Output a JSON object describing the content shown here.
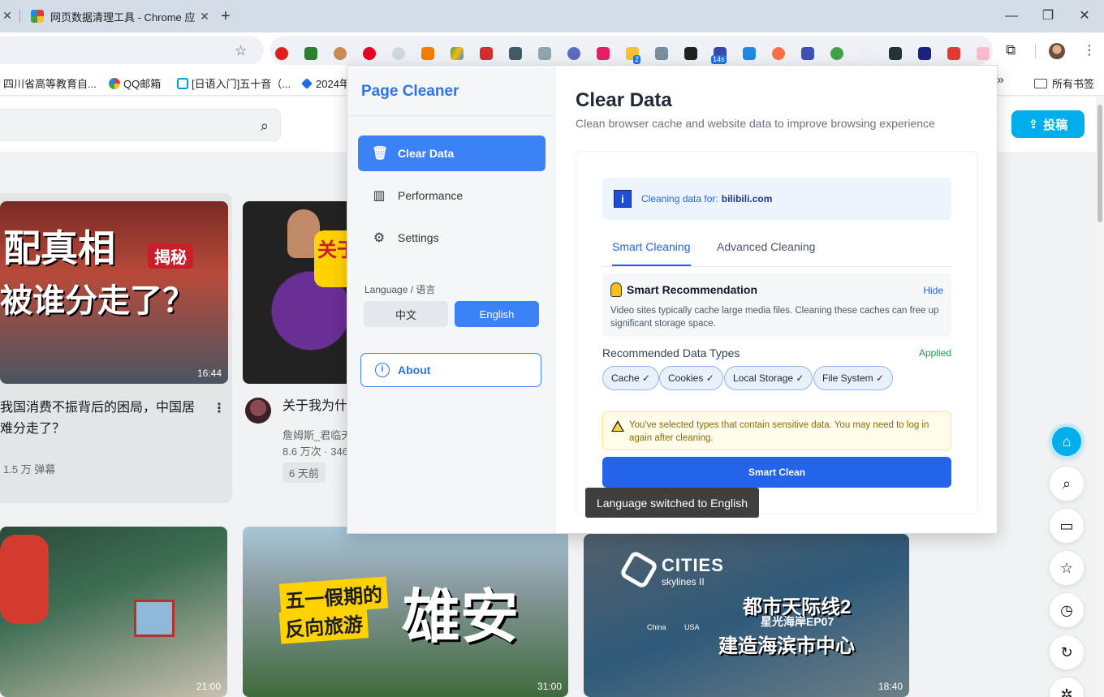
{
  "browser": {
    "tab_title": "网页数据清理工具 - Chrome 应",
    "bookmarks": [
      "四川省高等教育自...",
      "QQ邮箱",
      "[日语入门]五十音（...",
      "2024年"
    ],
    "all_bookmarks": "所有书签",
    "ext_badge_1": "2",
    "ext_badge_2": "14s"
  },
  "page": {
    "upload_label": "投稿",
    "card1": {
      "thumb_line1": "配真相",
      "thumb_line2": "被谁分走了？",
      "thumb_tag": "揭秘",
      "duration": "16:44",
      "title_line1": "我国消费不振背后的困局，中国居",
      "title_line2": "难分走了？",
      "meta": "1.5 万 弹幕"
    },
    "card2": {
      "thumb_text": "关于",
      "title": "关于我为什",
      "author": "詹姆斯_君临天",
      "stats": "8.6 万次 · 346",
      "date": "6 天前"
    },
    "card4": {
      "line1": "五一假期的",
      "line2": "反向旅游",
      "big": "雄安",
      "duration": "31:00"
    },
    "card5": {
      "logo": "CITIES",
      "logo_sub": "skylines II",
      "cn1": "都市天际线2",
      "cn2": "星光海岸EP07",
      "cn3": "建造海滨市中心",
      "pin1": "China",
      "pin2": "USA",
      "duration": "18:40"
    },
    "card3_duration": "21:00"
  },
  "popup": {
    "brand": "Page Cleaner",
    "nav": [
      {
        "label": "Clear Data",
        "icon": "trash-icon"
      },
      {
        "label": "Performance",
        "icon": "chart-icon"
      },
      {
        "label": "Settings",
        "icon": "gear-icon"
      }
    ],
    "language_label": "Language / 语言",
    "lang_cn": "中文",
    "lang_en": "English",
    "about": "About",
    "title": "Clear Data",
    "subtitle": "Clean browser cache and website data to improve browsing experience",
    "info_prefix": "Cleaning data for:",
    "info_domain": "bilibili.com",
    "tabs": [
      "Smart Cleaning",
      "Advanced Cleaning"
    ],
    "reco_title": "Smart Recommendation",
    "reco_hide": "Hide",
    "reco_text": "Video sites typically cache large media files. Cleaning these caches can free up significant storage space.",
    "types_label": "Recommended Data Types",
    "applied": "Applied",
    "chips": [
      "Cache ✓",
      "Cookies ✓",
      "Local Storage ✓",
      "File System ✓"
    ],
    "warning": "You've selected types that contain sensitive data. You may need to log in again after cleaning.",
    "smart_clean": "Smart Clean"
  },
  "toast": "Language switched to English"
}
